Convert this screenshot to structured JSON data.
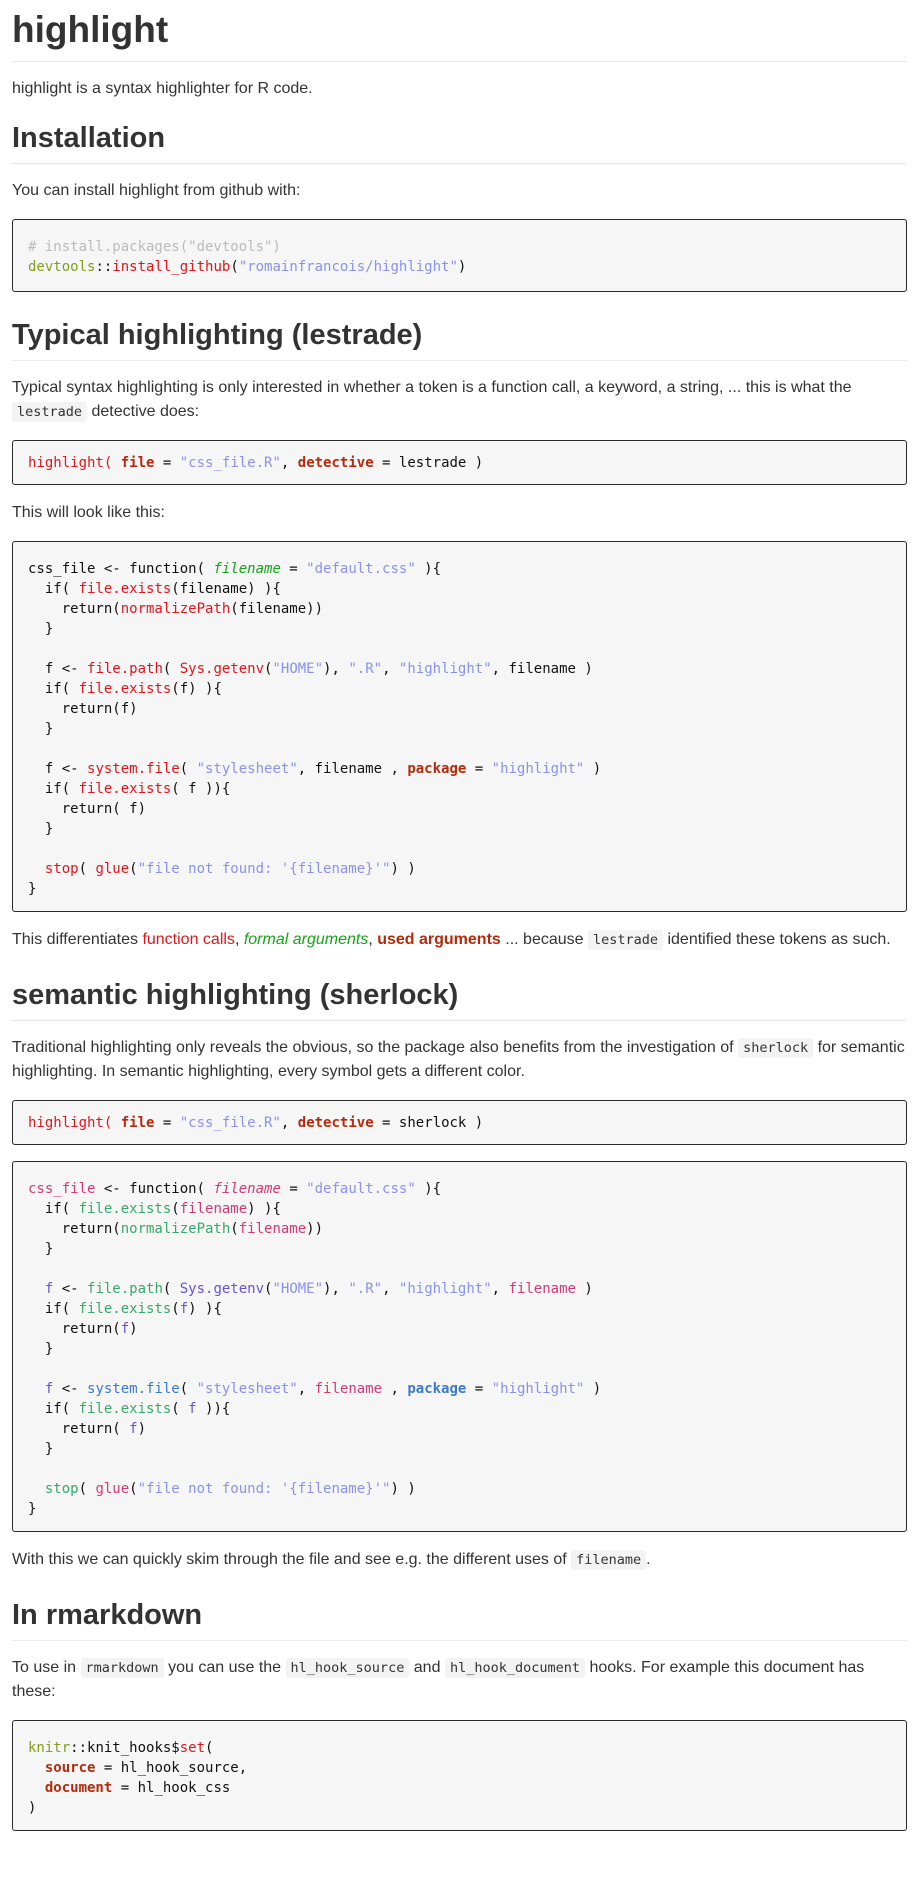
{
  "title": "highlight",
  "intro": "highlight is a syntax highlighter for R code.",
  "installation": {
    "heading": "Installation",
    "text": "You can install highlight from github with:",
    "code": {
      "comment": "# install.packages(\"devtools\")",
      "ns": "devtools",
      "sep": "::",
      "fn": "install_github",
      "open": "(",
      "str": "\"romainfrancois/highlight\"",
      "close": ")"
    }
  },
  "typical": {
    "heading": "Typical highlighting (lestrade)",
    "text_before": "Typical syntax highlighting is only interested in whether a token is a function call, a keyword, a string, ... this is what the",
    "code_word": "lestrade",
    "text_after": "detective does:",
    "call": {
      "fn": "highlight(",
      "arg1": "file",
      "eq1": " = ",
      "str1": "\"css_file.R\"",
      "comma": ", ",
      "arg2": "detective",
      "eq2": " = ",
      "value": "lestrade )"
    },
    "look_text": "This will look like this:",
    "diff": {
      "text1": "This differentiates ",
      "function_calls": "function calls",
      "sep1": ", ",
      "formal_arguments": "formal arguments",
      "sep2": ", ",
      "used_arguments": "used arguments",
      "text2": " ... because ",
      "code_word": "lestrade",
      "text3": " identified these tokens as such."
    }
  },
  "semantic": {
    "heading": "semantic highlighting (sherlock)",
    "text_before": "Traditional highlighting only reveals the obvious, so the package also benefits from the investigation of",
    "code_word": "sherlock",
    "text_after": "for semantic highlighting. In semantic highlighting, every symbol gets a different color.",
    "call": {
      "fn": "highlight(",
      "arg1": "file",
      "eq1": " = ",
      "str1": "\"css_file.R\"",
      "comma": ", ",
      "arg2": "detective",
      "eq2": " = ",
      "value": "sherlock )"
    },
    "skim_before": "With this we can quickly skim through the file and see e.g. the different uses of",
    "skim_code": "filename",
    "skim_after": "."
  },
  "rmarkdown": {
    "heading": "In rmarkdown",
    "t1": "To use in",
    "c1": "rmarkdown",
    "t2": "you can use the",
    "c2": "hl_hook_source",
    "t3": "and",
    "c3": "hl_hook_document",
    "t4": "hooks. For example this document has these:",
    "code": {
      "l1_ns": "knitr",
      "l1_sep": "::",
      "l1_obj": "knit_hooks$",
      "l1_fn": "set",
      "l1_open": "(",
      "l2_arg": "source",
      "l2_rest": " = hl_hook_source,",
      "l3_arg": "document",
      "l3_rest": " = hl_hook_css",
      "l4": ")"
    }
  },
  "code_lines": {
    "lestrade": [
      [
        [
          "t",
          "css_file <- function( "
        ],
        [
          "farg",
          "filename"
        ],
        [
          "t",
          " = "
        ],
        [
          "str",
          "\"default.css\""
        ],
        [
          "t",
          " ){"
        ]
      ],
      [
        [
          "t",
          "  if( "
        ],
        [
          "fn",
          "file.exists"
        ],
        [
          "t",
          "(filename) ){"
        ]
      ],
      [
        [
          "t",
          "    return("
        ],
        [
          "fn",
          "normalizePath"
        ],
        [
          "t",
          "(filename))"
        ]
      ],
      [
        [
          "t",
          "  }"
        ]
      ],
      [
        [
          "t",
          ""
        ]
      ],
      [
        [
          "t",
          "  f <- "
        ],
        [
          "fn",
          "file.path"
        ],
        [
          "t",
          "( "
        ],
        [
          "fn",
          "Sys.getenv"
        ],
        [
          "t",
          "("
        ],
        [
          "str",
          "\"HOME\""
        ],
        [
          "t",
          "), "
        ],
        [
          "str",
          "\".R\""
        ],
        [
          "t",
          ", "
        ],
        [
          "str",
          "\"highlight\""
        ],
        [
          "t",
          ", filename )"
        ]
      ],
      [
        [
          "t",
          "  if( "
        ],
        [
          "fn",
          "file.exists"
        ],
        [
          "t",
          "(f) ){"
        ]
      ],
      [
        [
          "t",
          "    return(f)"
        ]
      ],
      [
        [
          "t",
          "  }"
        ]
      ],
      [
        [
          "t",
          ""
        ]
      ],
      [
        [
          "t",
          "  f <- "
        ],
        [
          "fn",
          "system.file"
        ],
        [
          "t",
          "( "
        ],
        [
          "str",
          "\"stylesheet\""
        ],
        [
          "t",
          ", filename , "
        ],
        [
          "arg",
          "package"
        ],
        [
          "t",
          " = "
        ],
        [
          "str",
          "\"highlight\""
        ],
        [
          "t",
          " )"
        ]
      ],
      [
        [
          "t",
          "  if( "
        ],
        [
          "fn",
          "file.exists"
        ],
        [
          "t",
          "( f )){"
        ]
      ],
      [
        [
          "t",
          "    return( f)"
        ]
      ],
      [
        [
          "t",
          "  }"
        ]
      ],
      [
        [
          "t",
          ""
        ]
      ],
      [
        [
          "t",
          "  "
        ],
        [
          "fn",
          "stop"
        ],
        [
          "t",
          "( "
        ],
        [
          "fn",
          "glue"
        ],
        [
          "t",
          "("
        ],
        [
          "str",
          "\"file not found: '{filename}'\""
        ],
        [
          "t",
          ") )"
        ]
      ],
      [
        [
          "t",
          "}"
        ]
      ]
    ],
    "sherlock": [
      [
        [
          "s-var",
          "css_file"
        ],
        [
          "t",
          " <- function( "
        ],
        [
          "s-arg-i",
          "filename"
        ],
        [
          "t",
          " = "
        ],
        [
          "str",
          "\"default.css\""
        ],
        [
          "t",
          " ){"
        ]
      ],
      [
        [
          "t",
          "  if( "
        ],
        [
          "s-fn",
          "file.exists"
        ],
        [
          "t",
          "("
        ],
        [
          "s-var",
          "filename"
        ],
        [
          "t",
          ") ){"
        ]
      ],
      [
        [
          "t",
          "    return("
        ],
        [
          "s-fn",
          "normalizePath"
        ],
        [
          "t",
          "("
        ],
        [
          "s-var",
          "filename"
        ],
        [
          "t",
          "))"
        ]
      ],
      [
        [
          "t",
          "  }"
        ]
      ],
      [
        [
          "t",
          ""
        ]
      ],
      [
        [
          "t",
          "  "
        ],
        [
          "s-f",
          "f"
        ],
        [
          "t",
          " <- "
        ],
        [
          "s-fn",
          "file.path"
        ],
        [
          "t",
          "( "
        ],
        [
          "s-f",
          "Sys.getenv"
        ],
        [
          "t",
          "("
        ],
        [
          "str",
          "\"HOME\""
        ],
        [
          "t",
          "), "
        ],
        [
          "str",
          "\".R\""
        ],
        [
          "t",
          ", "
        ],
        [
          "str",
          "\"highlight\""
        ],
        [
          "t",
          ", "
        ],
        [
          "s-var",
          "filename"
        ],
        [
          "t",
          " )"
        ]
      ],
      [
        [
          "t",
          "  if( "
        ],
        [
          "s-fn",
          "file.exists"
        ],
        [
          "t",
          "("
        ],
        [
          "s-f",
          "f"
        ],
        [
          "t",
          ") ){"
        ]
      ],
      [
        [
          "t",
          "    return("
        ],
        [
          "s-f",
          "f"
        ],
        [
          "t",
          ")"
        ]
      ],
      [
        [
          "t",
          "  }"
        ]
      ],
      [
        [
          "t",
          ""
        ]
      ],
      [
        [
          "t",
          "  "
        ],
        [
          "s-f",
          "f"
        ],
        [
          "t",
          " <- "
        ],
        [
          "s-sys",
          "system.file"
        ],
        [
          "t",
          "( "
        ],
        [
          "str",
          "\"stylesheet\""
        ],
        [
          "t",
          ", "
        ],
        [
          "s-var",
          "filename"
        ],
        [
          "t",
          " , "
        ],
        [
          "s-pkg",
          "package"
        ],
        [
          "t",
          " = "
        ],
        [
          "str",
          "\"highlight\""
        ],
        [
          "t",
          " )"
        ]
      ],
      [
        [
          "t",
          "  if( "
        ],
        [
          "s-fn",
          "file.exists"
        ],
        [
          "t",
          "( "
        ],
        [
          "s-f",
          "f"
        ],
        [
          "t",
          " )){"
        ]
      ],
      [
        [
          "t",
          "    return( "
        ],
        [
          "s-f",
          "f"
        ],
        [
          "t",
          ")"
        ]
      ],
      [
        [
          "t",
          "  }"
        ]
      ],
      [
        [
          "t",
          ""
        ]
      ],
      [
        [
          "t",
          "  "
        ],
        [
          "s-fn",
          "stop"
        ],
        [
          "t",
          "( "
        ],
        [
          "s-var",
          "glue"
        ],
        [
          "t",
          "("
        ],
        [
          "str",
          "\"file not found: '{filename}'\""
        ],
        [
          "t",
          ") )"
        ]
      ],
      [
        [
          "t",
          "}"
        ]
      ]
    ]
  }
}
